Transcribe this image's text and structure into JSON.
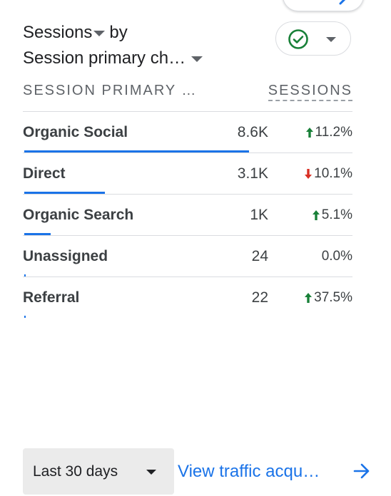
{
  "header": {
    "title_part1": "Sessions",
    "title_part2": "by",
    "title_part3": "Session primary ch…",
    "icons": {
      "top_pill_arrow": "arrow-icon",
      "status": "check-circle-icon",
      "dropdown": "chevron-down-icon"
    },
    "colors": {
      "status_green": "#188038"
    }
  },
  "table": {
    "col_left": "SESSION PRIMARY …",
    "col_right": "SESSIONS",
    "rows": [
      {
        "name": "Organic Social",
        "value": "8.6K",
        "change": "11.2%",
        "direction": "up",
        "share": 0.685
      },
      {
        "name": "Direct",
        "value": "3.1K",
        "change": "10.1%",
        "direction": "down",
        "share": 0.245
      },
      {
        "name": "Organic Search",
        "value": "1K",
        "change": "5.1%",
        "direction": "up",
        "share": 0.08
      },
      {
        "name": "Unassigned",
        "value": "24",
        "change": "0.0%",
        "direction": "none",
        "share": 0.002
      },
      {
        "name": "Referral",
        "value": "22",
        "change": "37.5%",
        "direction": "up",
        "share": 0.002
      }
    ],
    "colors": {
      "bar": "#1a73e8",
      "up": "#188038",
      "down": "#d93025"
    }
  },
  "footer": {
    "date_range": "Last 30 days",
    "link_text": "View traffic acqu…",
    "link_icon": "arrow-right-icon",
    "link_color": "#1a73e8"
  }
}
